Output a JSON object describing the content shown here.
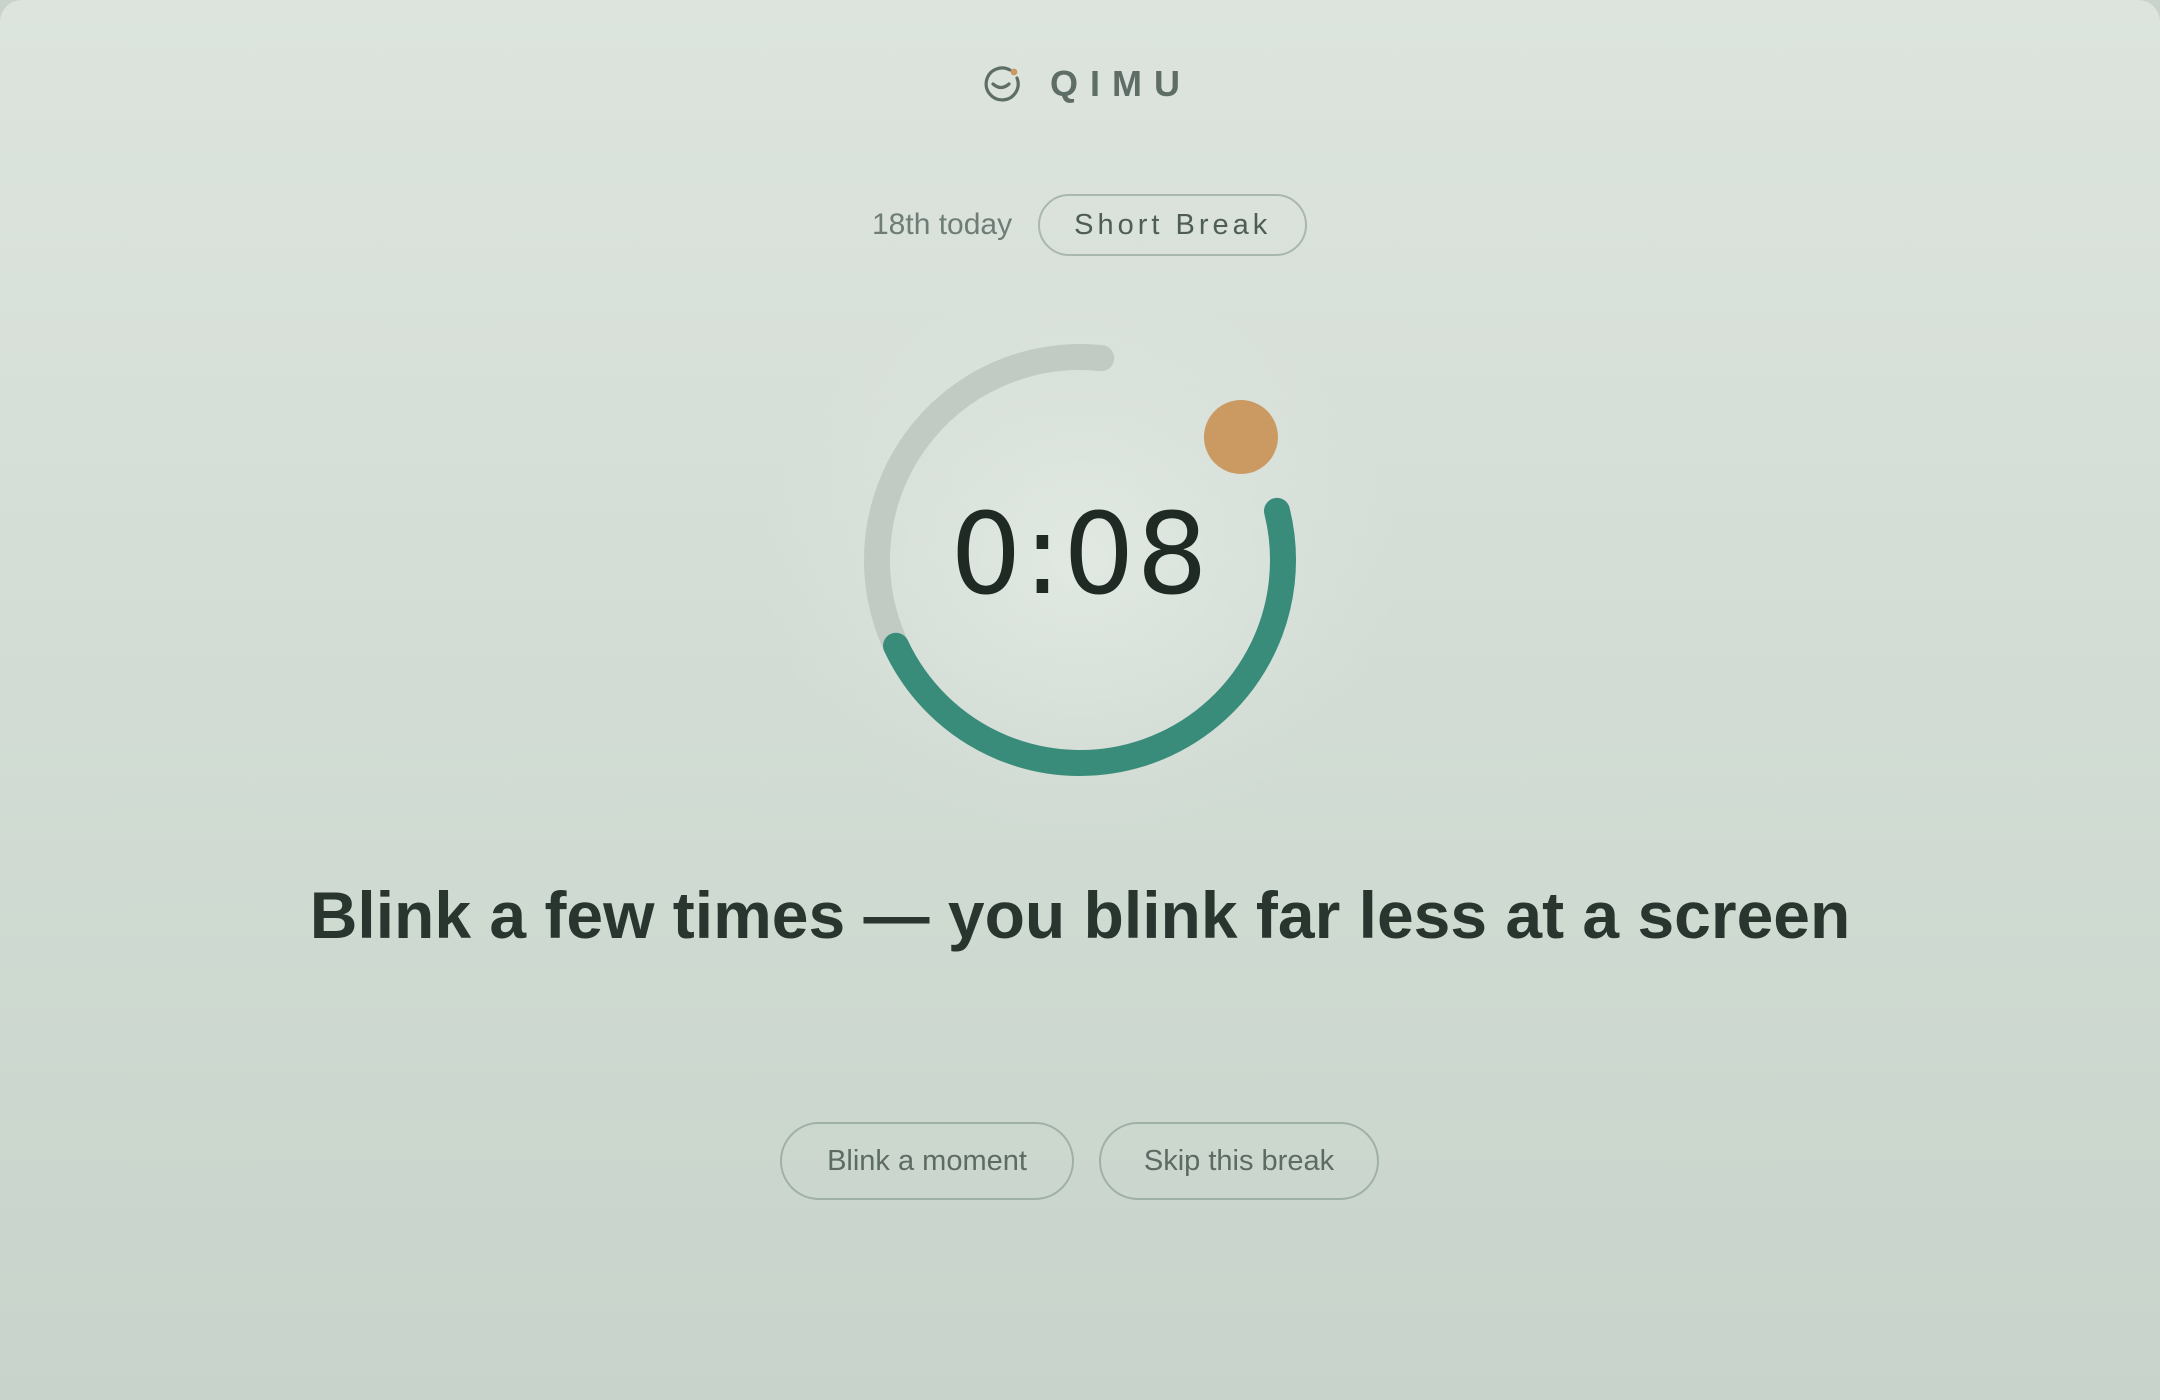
{
  "app": {
    "name": "QIMU",
    "logo_icon": "smile-face-icon"
  },
  "session": {
    "count_label": "18th today",
    "break_type": "Short Break"
  },
  "timer": {
    "remaining": "0:08",
    "progress_fraction": 0.62,
    "progress_color": "#3a8c7a",
    "track_color": "#c1cbc4",
    "marker_color": "#cb9a63"
  },
  "prompt": {
    "text": "Blink a few times — you blink far less at a screen"
  },
  "actions": {
    "blink_label": "Blink a moment",
    "skip_label": "Skip this break"
  }
}
